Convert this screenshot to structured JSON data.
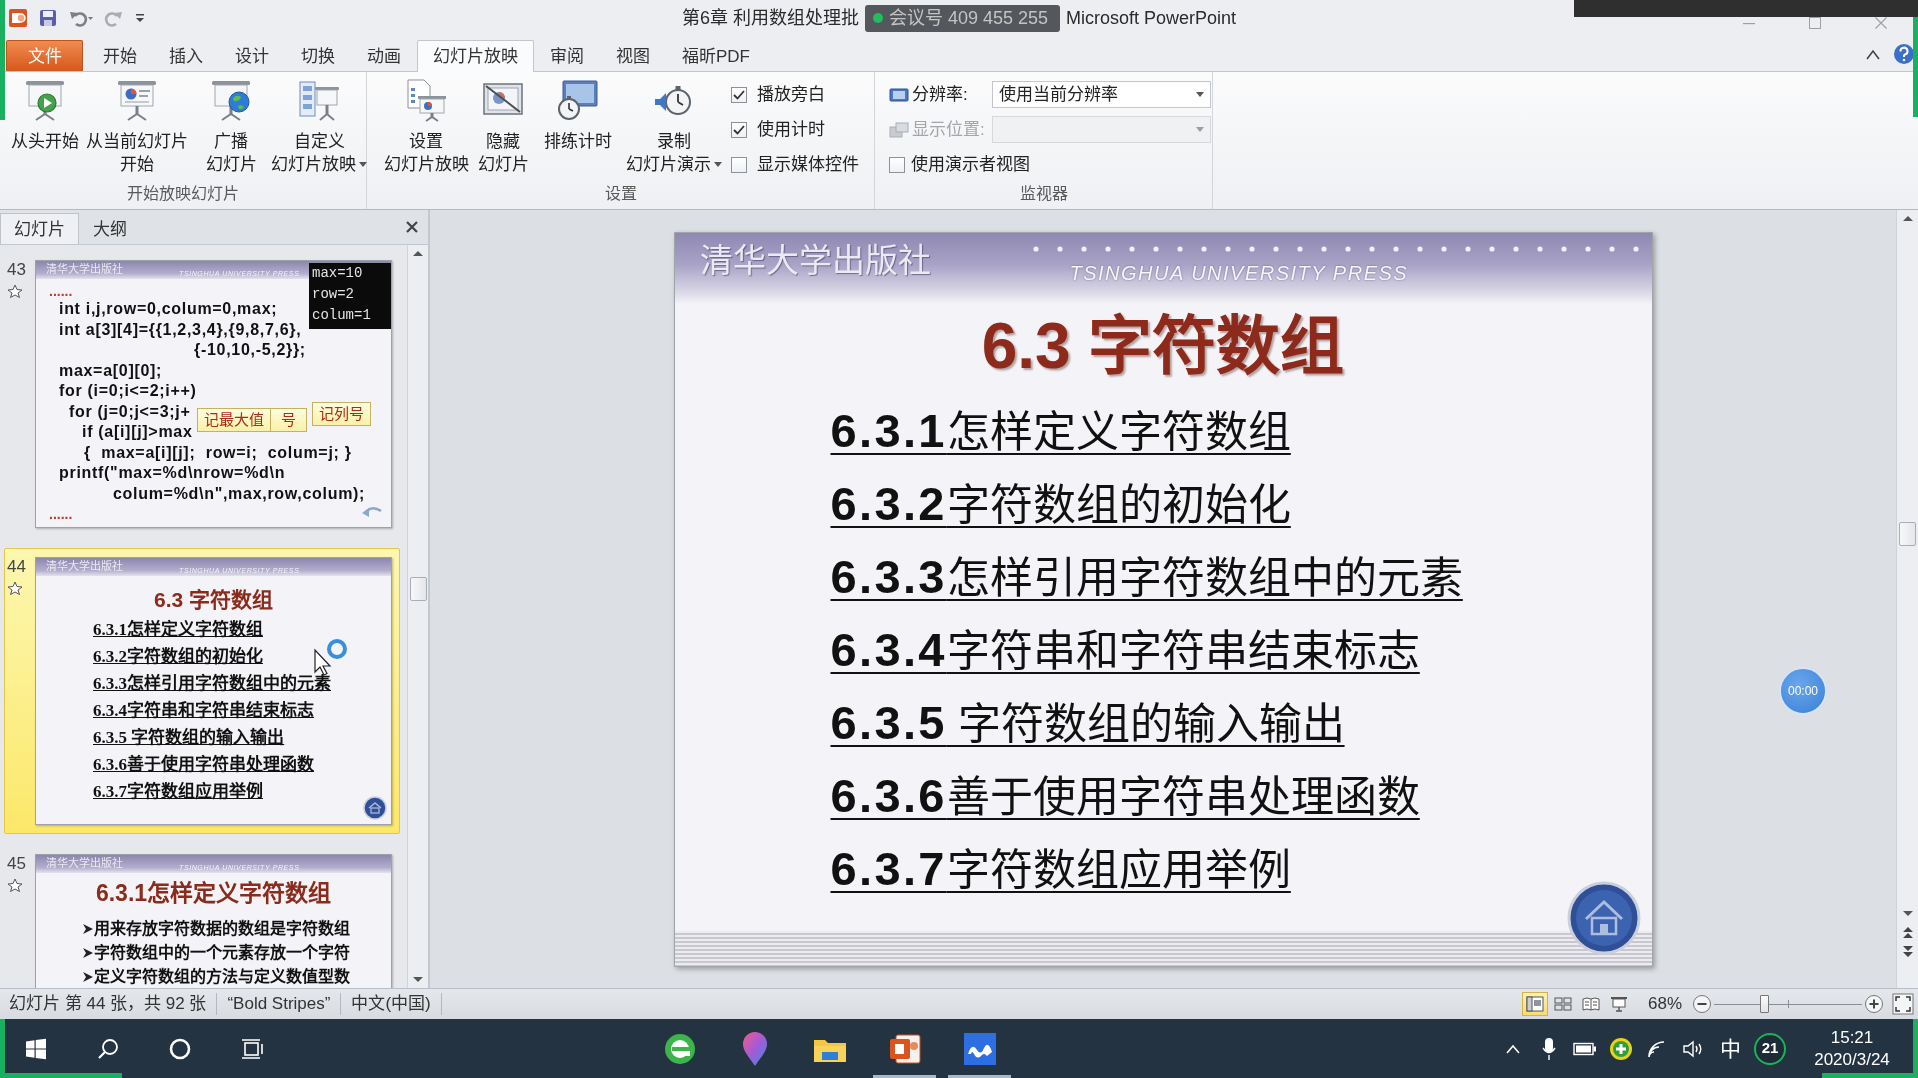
{
  "title_bar": {
    "title_start": "第6章 利用数组处理批",
    "meeting_overlay": "会议号 409 455 255",
    "title_end": "Microsoft PowerPoint"
  },
  "ribbon_tabs": [
    {
      "label": "文件",
      "kind": "file",
      "selected": false
    },
    {
      "label": "开始",
      "kind": "tab",
      "selected": false
    },
    {
      "label": "插入",
      "kind": "tab",
      "selected": false
    },
    {
      "label": "设计",
      "kind": "tab",
      "selected": false
    },
    {
      "label": "切换",
      "kind": "tab",
      "selected": false
    },
    {
      "label": "动画",
      "kind": "tab",
      "selected": false
    },
    {
      "label": "幻灯片放映",
      "kind": "tab",
      "selected": true
    },
    {
      "label": "审阅",
      "kind": "tab",
      "selected": false
    },
    {
      "label": "视图",
      "kind": "tab",
      "selected": false
    },
    {
      "label": "福昕PDF",
      "kind": "tab",
      "selected": false
    }
  ],
  "ribbon_groups": [
    {
      "label": "开始放映幻灯片",
      "buttons": [
        {
          "lines": [
            "从头开始"
          ],
          "dropdown": false
        },
        {
          "lines": [
            "从当前幻灯片",
            "开始"
          ],
          "dropdown": false
        },
        {
          "lines": [
            "广播",
            "幻灯片"
          ],
          "dropdown": false
        },
        {
          "lines": [
            "自定义",
            "幻灯片放映"
          ],
          "dropdown": true
        }
      ]
    },
    {
      "label": "设置",
      "buttons": [
        {
          "lines": [
            "设置",
            "幻灯片放映"
          ],
          "dropdown": false
        },
        {
          "lines": [
            "隐藏",
            "幻灯片"
          ],
          "dropdown": false
        },
        {
          "lines": [
            "排练计时"
          ],
          "dropdown": false
        },
        {
          "lines": [
            "录制",
            "幻灯片演示"
          ],
          "dropdown": true
        }
      ],
      "checkboxes": [
        {
          "label": "播放旁白",
          "checked": true
        },
        {
          "label": "使用计时",
          "checked": true
        },
        {
          "label": "显示媒体控件",
          "checked": false
        }
      ]
    },
    {
      "label": "监视器",
      "fields": [
        {
          "label": "分辨率:",
          "value": "使用当前分辨率",
          "disabled": false
        },
        {
          "label": "显示位置:",
          "disabled": true
        }
      ],
      "checkboxes": [
        {
          "label": "使用演示者视图",
          "checked": false
        }
      ]
    }
  ],
  "slide_panel": {
    "tabs": [
      {
        "label": "幻灯片",
        "selected": true
      },
      {
        "label": "大纲",
        "selected": false
      }
    ],
    "slides": [
      {
        "number": "43",
        "selected": false,
        "animated": true,
        "kind": "code",
        "header": "清华大学出版社",
        "header_en": "TSINGHUA UNIVERSITY PRESS",
        "lead": "......",
        "code": [
          "int i,j,row=0,colum=0,max;",
          "int a[3][4]={{1,2,3,4},{9,8,7,6},",
          "{-10,10,-5,2}};",
          "max=a[0][0];",
          "for (i=0;i<=2;i++)",
          "for (j=0;j<=3;j+",
          "if (a[i][j]>max",
          "{  max=a[i][j];  row=i;  colum=j; }",
          "printf(\"max=%d\\nrow=%d\\n",
          "colum=%d\\n\",max,row,colum);"
        ],
        "trail": "......",
        "output": [
          "max=10",
          "row=2",
          "colum=1"
        ],
        "callouts": [
          "记最大值",
          "号",
          "记列号"
        ]
      },
      {
        "number": "44",
        "selected": true,
        "animated": true,
        "kind": "toc",
        "header": "清华大学出版社",
        "header_en": "TSINGHUA UNIVERSITY PRESS",
        "title": "6.3 字符数组",
        "items": [
          "6.3.1怎样定义字符数组",
          "6.3.2字符数组的初始化",
          "6.3.3怎样引用字符数组中的元素",
          "6.3.4字符串和字符串结束标志",
          "6.3.5 字符数组的输入输出",
          "6.3.6善于使用字符串处理函数",
          "6.3.7字符数组应用举例"
        ]
      },
      {
        "number": "45",
        "selected": false,
        "animated": true,
        "kind": "bullets",
        "header": "清华大学出版社",
        "header_en": "TSINGHUA UNIVERSITY PRESS",
        "title": "6.3.1怎样定义字符数组",
        "bullets": [
          "用来存放字符数据的数组是字符数组",
          "字符数组中的一个元素存放一个字符",
          "定义字符数组的方法与定义数值型数"
        ]
      }
    ]
  },
  "slide": {
    "header": "清华大学出版社",
    "header_en": "TSINGHUA UNIVERSITY PRESS",
    "title": "6.3 字符数组",
    "items": [
      "**6.3.1**怎样定义字符数组",
      "**6.3.2**字符数组的初始化",
      "**6.3.3**怎样引用字符数组中的元素",
      "**6.3.4**字符串和字符串结束标志",
      "**6.3.5** 字符数组的输入输出",
      "**6.3.6**善于使用字符串处理函数",
      "**6.3.7**字符数组应用举例"
    ]
  },
  "timer_bubble": "00:00",
  "status_bar": {
    "slide_info": "幻灯片 第 44 张，共 92 张",
    "theme": "“Bold Stripes”",
    "language": "中文(中国)",
    "views": [
      {
        "selected": true
      },
      {
        "selected": false
      },
      {
        "selected": false
      },
      {
        "selected": false
      }
    ],
    "zoom": "68%",
    "zoom_slider": {
      "level": 0.34
    }
  },
  "taskbar": {
    "apps": [
      {
        "running": false
      },
      {
        "running": false
      },
      {
        "running": false
      },
      {
        "running": true
      },
      {
        "running": true
      }
    ],
    "ime": "中",
    "notifications": "21",
    "time": "15:21",
    "date": "2020/3/24"
  }
}
